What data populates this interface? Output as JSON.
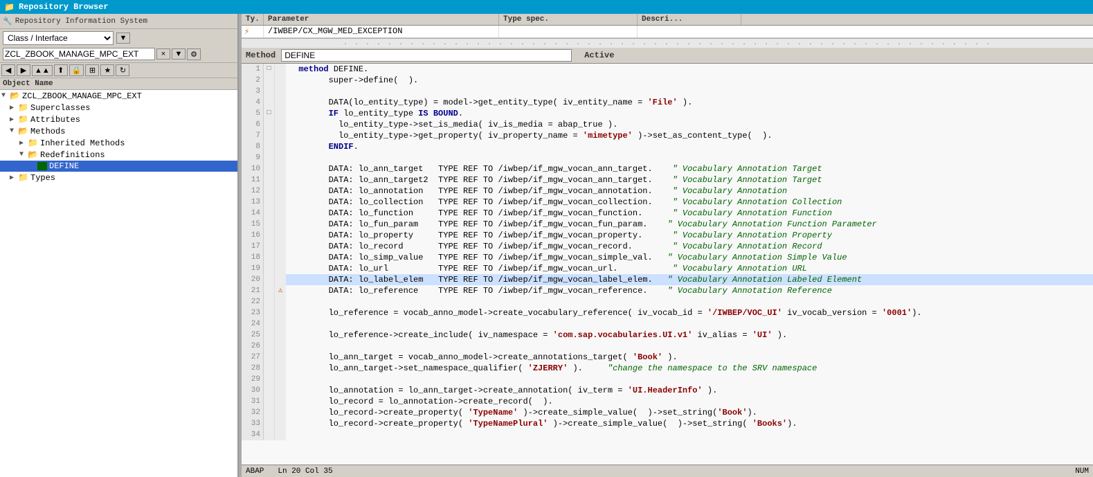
{
  "app": {
    "title": "Repository Browser"
  },
  "toolbar_ris": {
    "label": "Repository Information System"
  },
  "left": {
    "dropdown_label": "Class / Interface",
    "object_name": "ZCL_ZBOOK_MANAGE_MPC_EXT",
    "object_name_label": "Object Name",
    "tree": [
      {
        "id": "root",
        "label": "ZCL_ZBOOK_MANAGE_MPC_EXT",
        "indent": 0,
        "type": "root",
        "expanded": true
      },
      {
        "id": "superclasses",
        "label": "Superclasses",
        "indent": 1,
        "type": "folder",
        "expanded": false
      },
      {
        "id": "attributes",
        "label": "Attributes",
        "indent": 1,
        "type": "folder",
        "expanded": false
      },
      {
        "id": "methods",
        "label": "Methods",
        "indent": 1,
        "type": "folder",
        "expanded": true
      },
      {
        "id": "inherited",
        "label": "Inherited Methods",
        "indent": 2,
        "type": "subfolder",
        "expanded": false
      },
      {
        "id": "redefinitions",
        "label": "Redefinitions",
        "indent": 2,
        "type": "subfolder",
        "expanded": true
      },
      {
        "id": "define",
        "label": "DEFINE",
        "indent": 3,
        "type": "item",
        "expanded": false,
        "selected": true
      },
      {
        "id": "types",
        "label": "Types",
        "indent": 1,
        "type": "folder",
        "expanded": false
      }
    ]
  },
  "param_header": {
    "ty_col": "Ty.",
    "param_col": "Parameter",
    "type_spec_col": "Type spec.",
    "descri_col": "Descri..."
  },
  "param_row": {
    "icon": "⚡",
    "parameter": "/IWBEP/CX_MGW_MED_EXCEPTION",
    "type_spec": "",
    "descri": ""
  },
  "method_bar": {
    "label": "Method",
    "value": "DEFINE",
    "active": "Active"
  },
  "code_lines": [
    {
      "num": 1,
      "expand": "□",
      "error": "",
      "content": "  <kw>method</kw> DEFINE.",
      "highlighted": false
    },
    {
      "num": 2,
      "expand": "",
      "error": "",
      "content": "        super-&gt;define(  ).",
      "highlighted": false
    },
    {
      "num": 3,
      "expand": "",
      "error": "",
      "content": "",
      "highlighted": false
    },
    {
      "num": 4,
      "expand": "",
      "error": "",
      "content": "        DATA(lo_entity_type) = model-&gt;get_entity_type( iv_entity_name = <str>'File'</str> ).",
      "highlighted": false
    },
    {
      "num": 5,
      "expand": "□",
      "error": "",
      "content": "        <kw>IF</kw> lo_entity_type <kw>IS BOUND</kw>.",
      "highlighted": false
    },
    {
      "num": 6,
      "expand": "",
      "error": "",
      "content": "          lo_entity_type-&gt;set_is_media( iv_is_media = abap_true ).",
      "highlighted": false
    },
    {
      "num": 7,
      "expand": "",
      "error": "",
      "content": "          lo_entity_type-&gt;get_property( iv_property_name = <str>'mimetype'</str> )-&gt;set_as_content_type(  ).",
      "highlighted": false
    },
    {
      "num": 8,
      "expand": "",
      "error": "",
      "content": "        <kw>ENDIF</kw>.",
      "highlighted": false
    },
    {
      "num": 9,
      "expand": "",
      "error": "",
      "content": "",
      "highlighted": false
    },
    {
      "num": 10,
      "expand": "",
      "error": "",
      "content": "        DATA: lo_ann_target   TYPE REF TO /iwbep/if_mgw_vocan_ann_target.    <comment>\" Vocabulary Annotation Target</comment>",
      "highlighted": false
    },
    {
      "num": 11,
      "expand": "",
      "error": "",
      "content": "        DATA: lo_ann_target2  TYPE REF TO /iwbep/if_mgw_vocan_ann_target.    <comment>\" Vocabulary Annotation Target</comment>",
      "highlighted": false
    },
    {
      "num": 12,
      "expand": "",
      "error": "",
      "content": "        DATA: lo_annotation   TYPE REF TO /iwbep/if_mgw_vocan_annotation.    <comment>\" Vocabulary Annotation</comment>",
      "highlighted": false
    },
    {
      "num": 13,
      "expand": "",
      "error": "",
      "content": "        DATA: lo_collection   TYPE REF TO /iwbep/if_mgw_vocan_collection.    <comment>\" Vocabulary Annotation Collection</comment>",
      "highlighted": false
    },
    {
      "num": 14,
      "expand": "",
      "error": "",
      "content": "        DATA: lo_function     TYPE REF TO /iwbep/if_mgw_vocan_function.      <comment>\" Vocabulary Annotation Function</comment>",
      "highlighted": false
    },
    {
      "num": 15,
      "expand": "",
      "error": "",
      "content": "        DATA: lo_fun_param    TYPE REF TO /iwbep/if_mgw_vocan_fun_param.    <comment>\" Vocabulary Annotation Function Parameter</comment>",
      "highlighted": false
    },
    {
      "num": 16,
      "expand": "",
      "error": "",
      "content": "        DATA: lo_property     TYPE REF TO /iwbep/if_mgw_vocan_property.      <comment>\" Vocabulary Annotation Property</comment>",
      "highlighted": false
    },
    {
      "num": 17,
      "expand": "",
      "error": "",
      "content": "        DATA: lo_record       TYPE REF TO /iwbep/if_mgw_vocan_record.        <comment>\" Vocabulary Annotation Record</comment>",
      "highlighted": false
    },
    {
      "num": 18,
      "expand": "",
      "error": "",
      "content": "        DATA: lo_simp_value   TYPE REF TO /iwbep/if_mgw_vocan_simple_val.   <comment>\" Vocabulary Annotation Simple Value</comment>",
      "highlighted": false
    },
    {
      "num": 19,
      "expand": "",
      "error": "",
      "content": "        DATA: lo_url          TYPE REF TO /iwbep/if_mgw_vocan_url.           <comment>\" Vocabulary Annotation URL</comment>",
      "highlighted": false
    },
    {
      "num": 20,
      "expand": "",
      "error": "",
      "content": "        DATA: lo_label_elem   TYPE REF TO /iwbep/if_mgw_vocan_label_elem.   <comment>\" Vocabulary Annotation Labeled Element</comment>",
      "highlighted": true
    },
    {
      "num": 21,
      "expand": "",
      "error": "⚠",
      "content": "        DATA: lo_reference    TYPE REF TO /iwbep/if_mgw_vocan_reference.    <comment>\" Vocabulary Annotation Reference</comment>",
      "highlighted": false
    },
    {
      "num": 22,
      "expand": "",
      "error": "",
      "content": "",
      "highlighted": false
    },
    {
      "num": 23,
      "expand": "",
      "error": "",
      "content": "        lo_reference = vocab_anno_model-&gt;create_vocabulary_reference( iv_vocab_id = <str>'/IWBEP/VOC_UI'</str> iv_vocab_version = <str>'0001'</str>).",
      "highlighted": false
    },
    {
      "num": 24,
      "expand": "",
      "error": "",
      "content": "",
      "highlighted": false
    },
    {
      "num": 25,
      "expand": "",
      "error": "",
      "content": "        lo_reference-&gt;create_include( iv_namespace = <str>'com.sap.vocabularies.UI.v1'</str> iv_alias = <str>'UI'</str> ).",
      "highlighted": false
    },
    {
      "num": 26,
      "expand": "",
      "error": "",
      "content": "",
      "highlighted": false
    },
    {
      "num": 27,
      "expand": "",
      "error": "",
      "content": "        lo_ann_target = vocab_anno_model-&gt;create_annotations_target( <str>'Book'</str> ).",
      "highlighted": false
    },
    {
      "num": 28,
      "expand": "",
      "error": "",
      "content": "        lo_ann_target-&gt;set_namespace_qualifier( <str>'ZJERRY'</str> ).     <comment>\"change the namespace to the SRV namespace</comment>",
      "highlighted": false
    },
    {
      "num": 29,
      "expand": "",
      "error": "",
      "content": "",
      "highlighted": false
    },
    {
      "num": 30,
      "expand": "",
      "error": "",
      "content": "        lo_annotation = lo_ann_target-&gt;create_annotation( iv_term = <str>'UI.HeaderInfo'</str> ).",
      "highlighted": false
    },
    {
      "num": 31,
      "expand": "",
      "error": "",
      "content": "        lo_record = lo_annotation-&gt;create_record(  ).",
      "highlighted": false
    },
    {
      "num": 32,
      "expand": "",
      "error": "",
      "content": "        lo_record-&gt;create_property( <str>'TypeName'</str> )-&gt;create_simple_value(  )-&gt;set_string(<str>'Book'</str>).",
      "highlighted": false
    },
    {
      "num": 33,
      "expand": "",
      "error": "",
      "content": "        lo_record-&gt;create_property( <str>'TypeNamePlural'</str> )-&gt;create_simple_value(  )-&gt;set_string( <str>'Books'</str>).",
      "highlighted": false
    },
    {
      "num": 34,
      "expand": "",
      "error": "",
      "content": "",
      "highlighted": false
    }
  ],
  "status_bar": {
    "lang": "ABAP",
    "position": "Ln 20 Col 35",
    "numlock": "NUM"
  }
}
